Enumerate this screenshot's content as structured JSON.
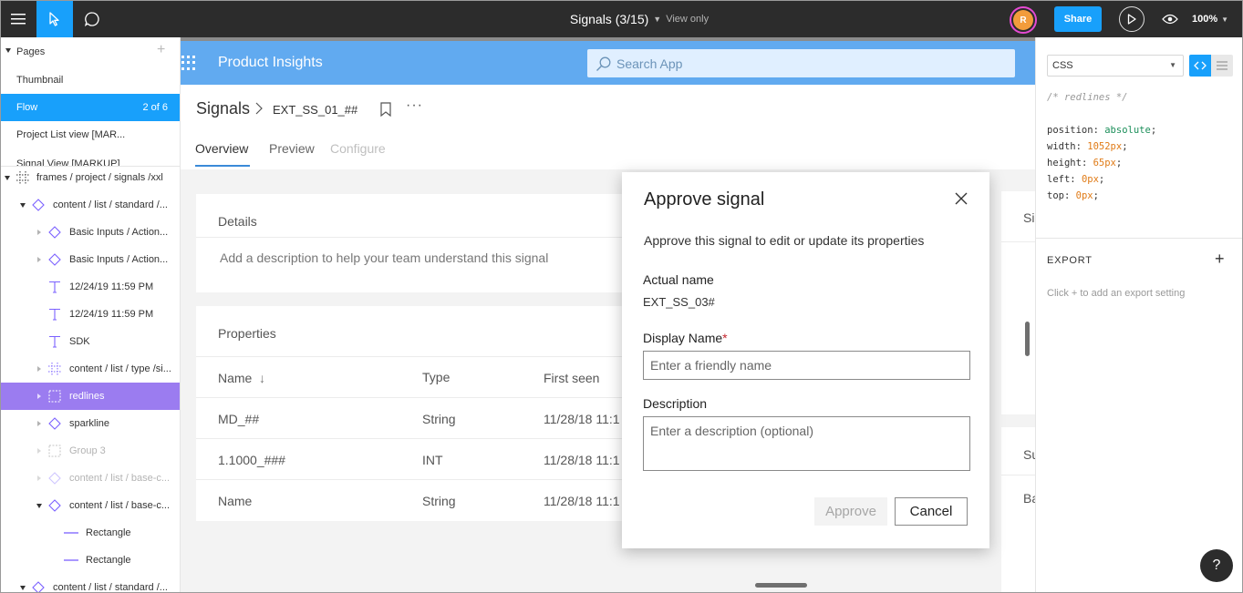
{
  "toolbar": {
    "title": "Signals (3/15)",
    "view_mode": "View only",
    "avatar_initial": "R",
    "share_label": "Share",
    "zoom": "100%"
  },
  "left_panel": {
    "pages_label": "Pages",
    "pages": [
      {
        "label": "Thumbnail"
      },
      {
        "label": "Flow",
        "count": "2 of 6"
      },
      {
        "label": "Project List view [MAR..."
      },
      {
        "label": "Signal View [MARKUP]"
      }
    ],
    "layers": [
      {
        "label": "frames / project / signals /xxl"
      },
      {
        "label": "content / list / standard /..."
      },
      {
        "label": "Basic Inputs / Action..."
      },
      {
        "label": "Basic Inputs / Action..."
      },
      {
        "label": "12/24/19 11:59 PM"
      },
      {
        "label": "12/24/19 11:59 PM"
      },
      {
        "label": "SDK"
      },
      {
        "label": "content / list / type /si..."
      },
      {
        "label": "redlines"
      },
      {
        "label": "sparkline"
      },
      {
        "label": "Group 3"
      },
      {
        "label": "content / list / base-c..."
      },
      {
        "label": "content / list / base-c..."
      },
      {
        "label": "Rectangle"
      },
      {
        "label": "Rectangle"
      },
      {
        "label": "content / list / standard /..."
      }
    ]
  },
  "app": {
    "title": "Product Insights",
    "search_placeholder": "Search App",
    "breadcrumb": "Signals",
    "breadcrumb_sub": "EXT_SS_01_##",
    "more": "···",
    "tabs": [
      "Overview",
      "Preview",
      "Configure"
    ],
    "details": {
      "title": "Details",
      "description": "Add a description to help your team understand this signal"
    },
    "properties": {
      "title": "Properties",
      "columns": [
        "Name",
        "Type",
        "First seen"
      ],
      "sort_arrow": "↓",
      "rows": [
        {
          "name": "MD_##",
          "type": "String",
          "first_seen": "11/28/18 11:1"
        },
        {
          "name": "1.1000_###",
          "type": "INT",
          "first_seen": "11/28/18 11:1"
        },
        {
          "name": "Name",
          "type": "String",
          "first_seen": "11/28/18 11:1"
        }
      ]
    },
    "right_cards": {
      "top": "Si",
      "bottom": "Su",
      "bottom_sub": "Ba"
    }
  },
  "dialog": {
    "title": "Approve signal",
    "subtitle": "Approve this signal to edit or update its properties",
    "actual_name_label": "Actual name",
    "actual_name_value": "EXT_SS_03#",
    "display_name_label": "Display Name",
    "required_mark": "*",
    "display_name_placeholder": "Enter a friendly name",
    "description_label": "Description",
    "description_placeholder": "Enter a description (optional)",
    "approve_label": "Approve",
    "cancel_label": "Cancel"
  },
  "right_panel": {
    "language": "CSS",
    "code_comment": "/* redlines */",
    "css": [
      {
        "prop": "position",
        "value": "absolute",
        "kind": "kw"
      },
      {
        "prop": "width",
        "value": "1052px",
        "kind": "nm"
      },
      {
        "prop": "height",
        "value": "65px",
        "kind": "nm"
      },
      {
        "prop": "left",
        "value": "0px",
        "kind": "nm"
      },
      {
        "prop": "top",
        "value": "0px",
        "kind": "nm"
      }
    ],
    "export_title": "EXPORT",
    "export_hint": "Click + to add an export setting",
    "help": "?"
  },
  "colors": {
    "toolbar_bg": "#2c2c2c",
    "accent": "#18a0fb",
    "selected_layer": "#9b7cf0",
    "app_header": "#61aaf0",
    "canvas_bg": "#8b8b8b"
  }
}
